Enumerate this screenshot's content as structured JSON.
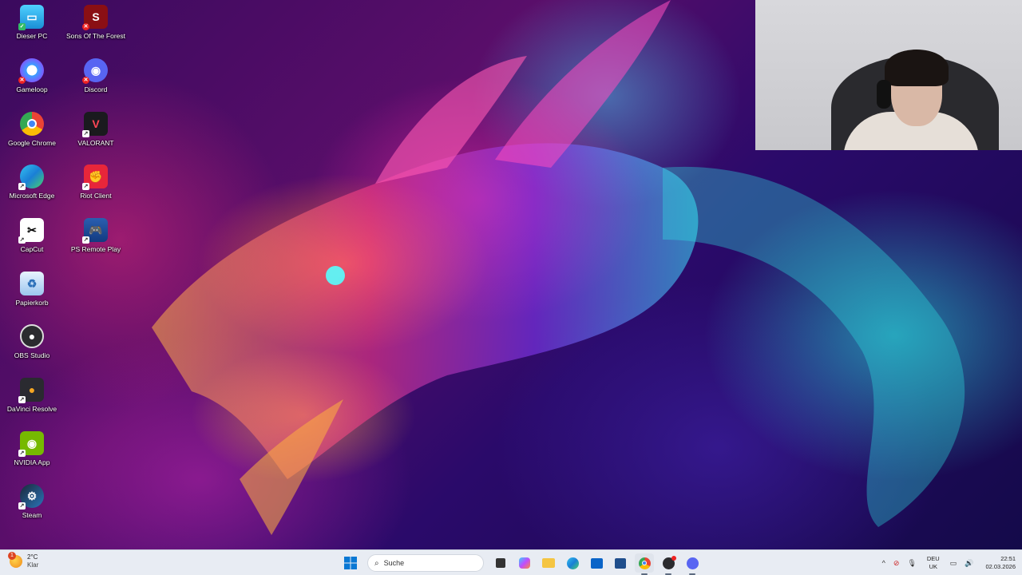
{
  "desktop": {
    "icons": [
      {
        "label": "Dieser PC",
        "icon": "computer-icon"
      },
      {
        "label": "Sons Of The Forest",
        "icon": "sons-of-the-forest-icon"
      },
      {
        "label": "Gameloop",
        "icon": "gameloop-icon"
      },
      {
        "label": "Discord",
        "icon": "discord-icon"
      },
      {
        "label": "Google Chrome",
        "icon": "chrome-icon"
      },
      {
        "label": "VALORANT",
        "icon": "valorant-icon"
      },
      {
        "label": "Microsoft Edge",
        "icon": "edge-icon"
      },
      {
        "label": "Riot Client",
        "icon": "riot-icon"
      },
      {
        "label": "CapCut",
        "icon": "capcut-icon"
      },
      {
        "label": "PS Remote Play",
        "icon": "ps-remote-play-icon"
      },
      {
        "label": "Papierkorb",
        "icon": "recycle-bin-icon"
      },
      {
        "label": "OBS Studio",
        "icon": "obs-icon"
      },
      {
        "label": "DaVinci Resolve",
        "icon": "davinci-icon"
      },
      {
        "label": "NVIDIA App",
        "icon": "nvidia-icon"
      },
      {
        "label": "Steam",
        "icon": "steam-icon"
      }
    ]
  },
  "taskbar": {
    "weather": {
      "temp": "2°C",
      "condition": "Klar",
      "badge": "1"
    },
    "search_placeholder": "Suche",
    "tray": {
      "lang_top": "DEU",
      "lang_bottom": "UK",
      "time": "22:51",
      "date": "02.03.2026"
    }
  },
  "colors": {
    "taskbar_bg": "#e8ecf3",
    "discord": "#5865f2",
    "valorant": "#ff4655",
    "nvidia": "#76b900"
  }
}
